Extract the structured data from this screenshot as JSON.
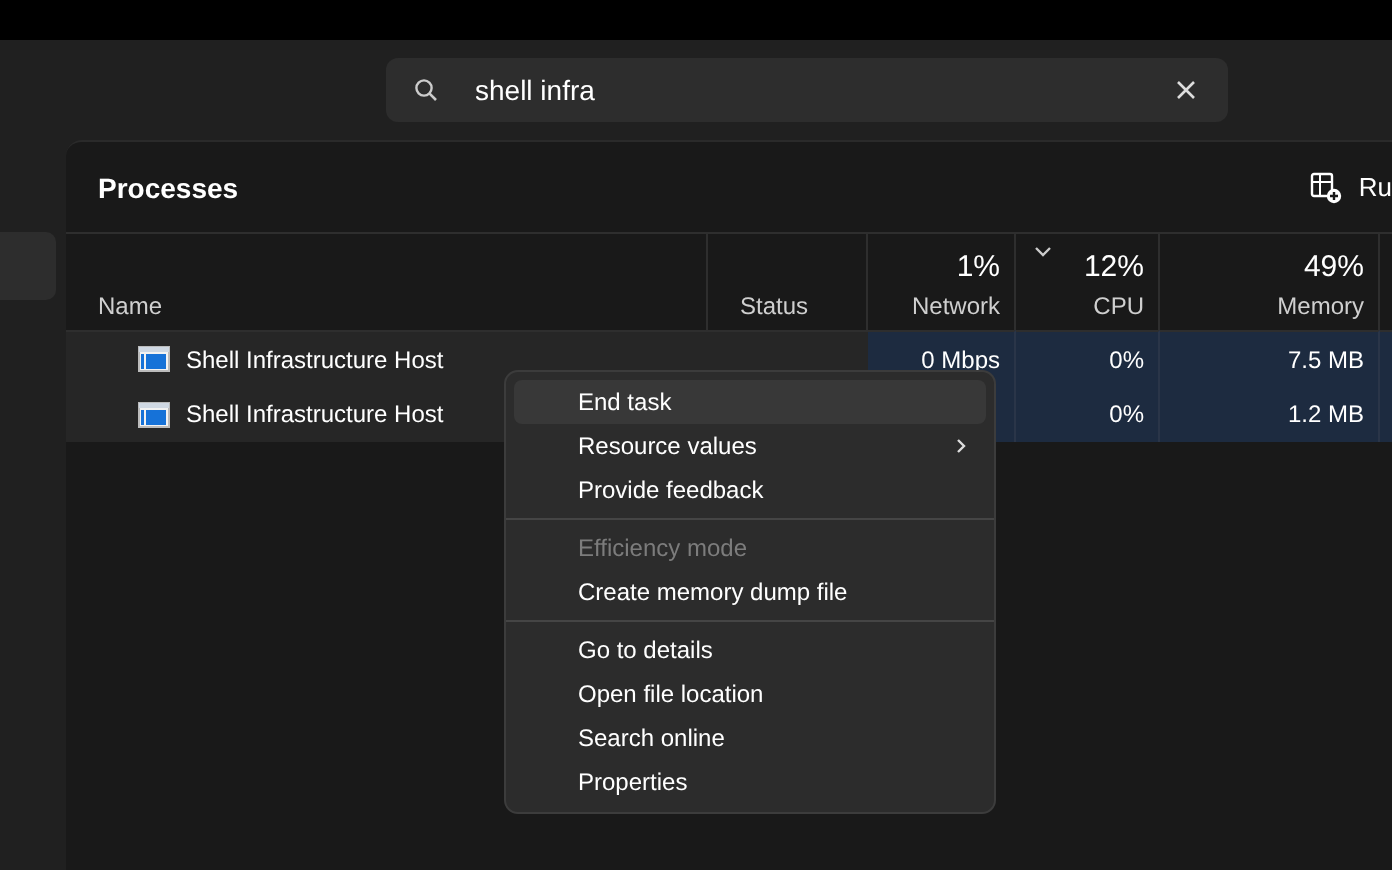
{
  "search": {
    "value": "shell infra"
  },
  "sidebar": {
    "items": [
      {
        "selected": true
      }
    ]
  },
  "panel": {
    "title": "Processes",
    "action": {
      "label": "Ru"
    }
  },
  "columns": [
    {
      "label": "Name"
    },
    {
      "label": "Status"
    },
    {
      "label": "Network",
      "usage": "1%",
      "sorted": false
    },
    {
      "label": "CPU",
      "usage": "12%",
      "sorted": true
    },
    {
      "label": "Memory",
      "usage": "49%",
      "sorted": false
    }
  ],
  "rows": [
    {
      "name": "Shell Infrastructure Host",
      "network": "0 Mbps",
      "cpu": "0%",
      "memory": "7.5 MB"
    },
    {
      "name": "Shell Infrastructure Host",
      "cpu": "0%",
      "memory": "1.2 MB"
    }
  ],
  "context_menu": {
    "items": [
      {
        "kind": "item",
        "label": "End task",
        "selected": true,
        "disabled": false,
        "submenu": false
      },
      {
        "kind": "item",
        "label": "Resource values",
        "selected": false,
        "disabled": false,
        "submenu": true
      },
      {
        "kind": "item",
        "label": "Provide feedback",
        "selected": false,
        "disabled": false,
        "submenu": false
      },
      {
        "kind": "separator"
      },
      {
        "kind": "item",
        "label": "Efficiency mode",
        "selected": false,
        "disabled": true,
        "submenu": false
      },
      {
        "kind": "item",
        "label": "Create memory dump file",
        "selected": false,
        "disabled": false,
        "submenu": false
      },
      {
        "kind": "separator"
      },
      {
        "kind": "item",
        "label": "Go to details",
        "selected": false,
        "disabled": false,
        "submenu": false
      },
      {
        "kind": "item",
        "label": "Open file location",
        "selected": false,
        "disabled": false,
        "submenu": false
      },
      {
        "kind": "item",
        "label": "Search online",
        "selected": false,
        "disabled": false,
        "submenu": false
      },
      {
        "kind": "item",
        "label": "Properties",
        "selected": false,
        "disabled": false,
        "submenu": false
      }
    ]
  }
}
